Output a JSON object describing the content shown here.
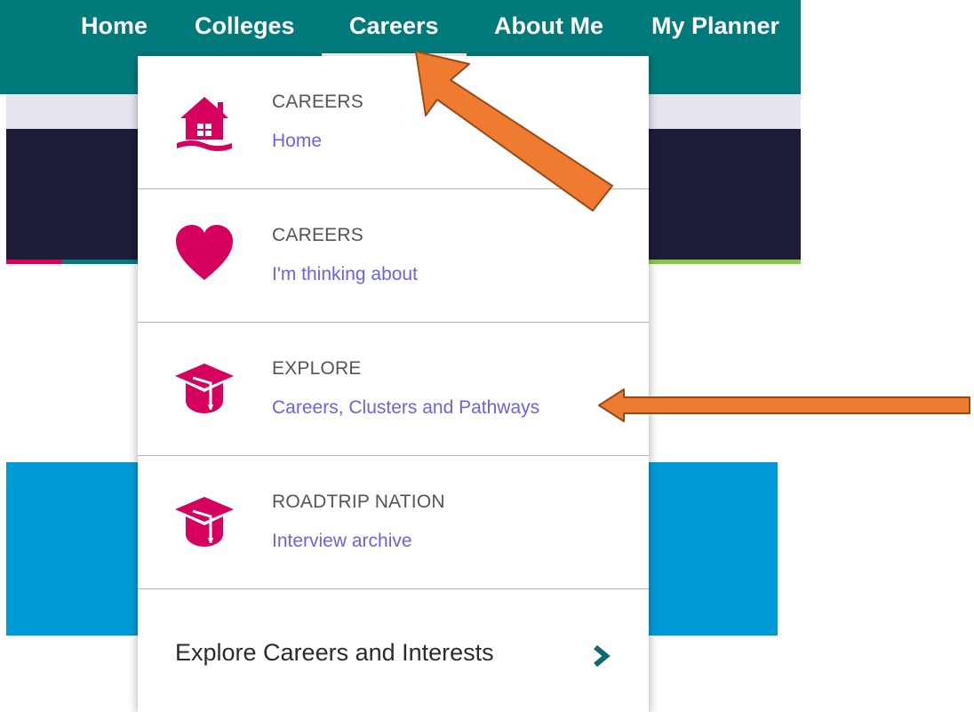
{
  "nav": {
    "items": [
      {
        "label": "Home"
      },
      {
        "label": "Colleges"
      },
      {
        "label": "Careers"
      },
      {
        "label": "About Me"
      },
      {
        "label": "My Planner"
      }
    ],
    "active": "Careers",
    "bar_color": "#007a7b"
  },
  "dropdown": {
    "items": [
      {
        "title": "CAREERS",
        "subtitle": "Home",
        "icon": "house-icon"
      },
      {
        "title": "CAREERS",
        "subtitle": "I'm thinking about",
        "icon": "heart-icon"
      },
      {
        "title": "EXPLORE",
        "subtitle": "Careers, Clusters and Pathways",
        "icon": "graduation-cap-icon"
      },
      {
        "title": "ROADTRIP NATION",
        "subtitle": "Interview archive",
        "icon": "graduation-cap-icon"
      }
    ],
    "bottom_link": {
      "label": "Explore Careers and Interests",
      "icon": "chevron-right-icon"
    }
  },
  "colors": {
    "icon_magenta": "#d6005f",
    "link_purple": "#6a64e0",
    "annotation_orange": "#ee7b2f",
    "hero_dark": "#1d1d38",
    "banner_blue": "#009bd6"
  }
}
